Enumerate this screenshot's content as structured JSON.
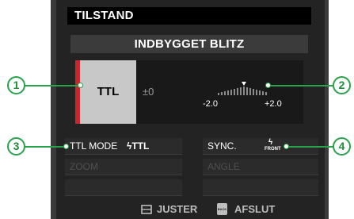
{
  "header": {
    "title": "TILSTAND"
  },
  "subtitle": "INDBYGGET BLITZ",
  "flash": {
    "mode": "TTL",
    "compensation": "±0",
    "scale_min": "-2.0",
    "scale_max": "+2.0"
  },
  "settings": {
    "ttl_mode_label": "TTL MODE",
    "ttl_mode_value": "ϟTTL",
    "sync_label": "SYNC.",
    "sync_value_front": "FRONT",
    "zoom_label": "ZOOM",
    "angle_label": "ANGLE"
  },
  "footer": {
    "adjust_label": "JUSTER",
    "back_icon_text": "BACK",
    "exit_label": "AFSLUT"
  },
  "callouts": [
    "1",
    "2",
    "3",
    "4"
  ],
  "colors": {
    "callout": "#2aa24b",
    "ttl_marker": "#c8282d",
    "screen_bg": "#232323"
  }
}
